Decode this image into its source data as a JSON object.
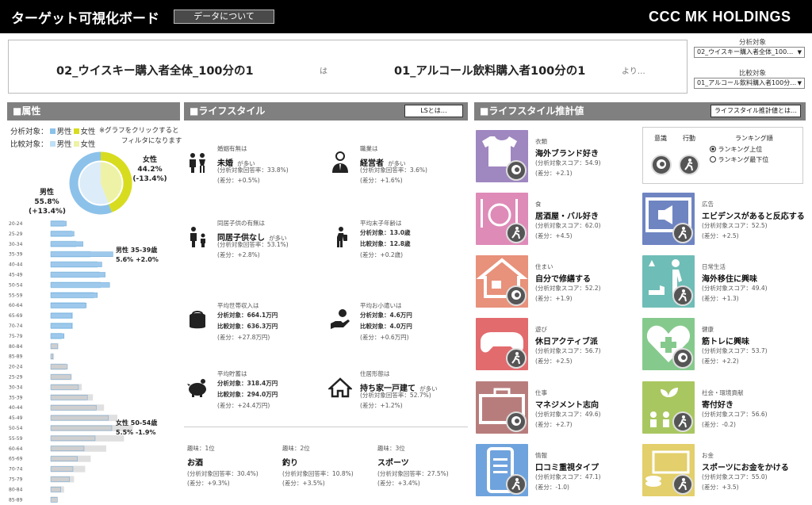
{
  "header": {
    "title": "ターゲット可視化ボード",
    "about_button": "データについて",
    "logo": "CCC MK HOLDINGS"
  },
  "comparison": {
    "target": "02_ウイスキー購入者全体_100分の1",
    "connector": "は",
    "base": "01_アルコール飲料購入者100分の1",
    "suffix": "より…",
    "target_select_label": "分析対象",
    "target_select_value": "02_ウイスキー購入者全体_100…",
    "base_select_label": "比較対象",
    "base_select_value": "01_アルコール飲料購入者100分…"
  },
  "attributes": {
    "heading": "■属性",
    "legend_target_label": "分析対象：",
    "legend_base_label": "比較対象：",
    "male": "男性",
    "female": "女性",
    "note_line1": "※グラフをクリックすると",
    "note_line2": "フィルタになります",
    "female_label": "女性",
    "female_pct": "44.2%",
    "female_diff": "(-13.4%)",
    "male_label": "男性",
    "male_pct": "55.8%",
    "male_diff": "(+13.4%)",
    "male_peak": "男性 35-39歳",
    "male_peak_val": "5.6% +2.0%",
    "female_peak": "女性 50-54歳",
    "female_peak_val": "5.5% -1.9%",
    "age_groups": [
      "20-24",
      "25-29",
      "30-34",
      "35-39",
      "40-44",
      "45-49",
      "50-54",
      "55-59",
      "60-64",
      "65-69",
      "70-74",
      "75-79",
      "80-84",
      "85-89"
    ],
    "male_target": [
      1.4,
      2.1,
      2.9,
      5.6,
      4.6,
      4.9,
      5.3,
      4.2,
      3.2,
      1.9,
      1.9,
      1.2,
      0,
      0
    ],
    "male_base": [
      1.2,
      1.9,
      2.3,
      3.6,
      4.2,
      4.4,
      4.5,
      3.9,
      3.1,
      2.0,
      2.0,
      1.0,
      0,
      0
    ],
    "female_target": [
      0,
      0,
      0,
      0,
      0,
      0,
      0,
      0,
      0,
      0,
      0,
      0,
      0.6,
      0.2
    ],
    "female_base": [
      0,
      0,
      0,
      0,
      0,
      0,
      0,
      0,
      0,
      0,
      0,
      0,
      0.7,
      0.3
    ],
    "female_ages": [
      "20-24",
      "25-29",
      "30-34",
      "35-39",
      "40-44",
      "45-49",
      "50-54",
      "55-59",
      "60-64",
      "65-69",
      "70-74",
      "75-79",
      "80-84",
      "85-89"
    ],
    "female_target2": [
      1.5,
      1.8,
      2.5,
      3.3,
      4.1,
      5.2,
      5.5,
      4.0,
      3.0,
      2.4,
      2.0,
      1.7,
      0.9,
      0.6
    ],
    "female_base2": [
      1.4,
      1.9,
      2.8,
      3.8,
      4.8,
      6.0,
      7.4,
      6.6,
      5.0,
      3.6,
      3.1,
      2.1,
      1.2,
      0.6
    ],
    "colors": {
      "male_target": "#9ec9ec",
      "male_base": "#bfe0f5",
      "female_target": "#cfcfcf",
      "female_base": "#e0e0e0",
      "donut_male": "#8cc2ea",
      "donut_female": "#d8dc1f"
    }
  },
  "lifestyle": {
    "heading": "■ライフスタイル",
    "button": "LSとは…",
    "items": [
      {
        "cat": "婚姻有無は",
        "main": "未婚",
        "tag": "が多い",
        "l1": "(分析対象回答率：33.8%)",
        "l2": "(差分：+0.5%)",
        "icon": "couple-icon"
      },
      {
        "cat": "職業は",
        "main": "経営者",
        "tag": "が多い",
        "l1": "(分析対象回答率：3.6%)",
        "l2": "(差分：+1.6%)",
        "icon": "executive-icon"
      },
      {
        "cat": "同居子供の有無は",
        "main": "同居子供なし",
        "tag": "が多い",
        "l1": "(分析対象回答率：53.1%)",
        "l2": "(差分：+2.8%)",
        "icon": "parent-child-icon"
      },
      {
        "cat": "平均末子年齢は",
        "main": "",
        "tag": "",
        "l1": "分析対象：13.0歳",
        "l2": "比較対象：12.8歳",
        "l3": "(差分：+0.2歳)",
        "icon": "child-walking-icon"
      },
      {
        "cat": "平均世帯収入は",
        "main": "",
        "tag": "",
        "l1": "分析対象：664.1万円",
        "l2": "比較対象：636.3万円",
        "l3": "(差分：+27.8万円)",
        "icon": "wallet-icon"
      },
      {
        "cat": "平均お小遣いは",
        "main": "",
        "tag": "",
        "l1": "分析対象：4.6万円",
        "l2": "比較対象：4.0万円",
        "l3": "(差分：+0.6万円)",
        "icon": "hand-coin-icon"
      },
      {
        "cat": "平均貯蓄は",
        "main": "",
        "tag": "",
        "l1": "分析対象：318.4万円",
        "l2": "比較対象：294.0万円",
        "l3": "(差分：+24.4万円)",
        "icon": "piggy-bank-icon"
      },
      {
        "cat": "住居形態は",
        "main": "持ち家一戸建て",
        "tag": "が多い",
        "l1": "(分析対象回答率：52.7%)",
        "l2": "(差分：+1.2%)",
        "icon": "house-icon"
      }
    ],
    "hobbies": [
      {
        "rank": "趣味：1位",
        "main": "お酒",
        "l1": "(分析対象回答率：30.4%)",
        "l2": "(差分：+9.3%)"
      },
      {
        "rank": "趣味：2位",
        "main": "釣り",
        "l1": "(分析対象回答率：10.8%)",
        "l2": "(差分：+3.5%)"
      },
      {
        "rank": "趣味：3位",
        "main": "スポーツ",
        "l1": "(分析対象回答率：27.5%)",
        "l2": "(差分：+3.4%)"
      }
    ]
  },
  "estimates": {
    "heading": "■ライフスタイル推計値",
    "button": "ライフスタイル推計値とは…",
    "legend": {
      "awareness": "意識",
      "action": "行動",
      "ranking_title": "ランキング順",
      "opt_top": "ランキング上位",
      "opt_bottom": "ランキング最下位"
    },
    "left": [
      {
        "cat": "衣類",
        "main": "海外ブランド好き",
        "score": "(分析対象スコア：54.9)",
        "diff": "(差分：+2.1)",
        "color": "#9f87c0",
        "icon": "tshirt-icon",
        "badge": "awareness-icon"
      },
      {
        "cat": "食",
        "main": "居酒屋・バル好き",
        "score": "(分析対象スコア：62.0)",
        "diff": "(差分：+4.5)",
        "color": "#de8bb8",
        "icon": "dining-icon",
        "badge": "action-icon"
      },
      {
        "cat": "住まい",
        "main": "自分で修繕する",
        "score": "(分析対象スコア：52.2)",
        "diff": "(差分：+1.9)",
        "color": "#e8917b",
        "icon": "home-icon",
        "badge": "awareness-icon"
      },
      {
        "cat": "遊び",
        "main": "休日アクティブ派",
        "score": "(分析対象スコア：56.7)",
        "diff": "(差分：+2.5)",
        "color": "#e26b6e",
        "icon": "gamepad-icon",
        "badge": "action-icon"
      },
      {
        "cat": "仕事",
        "main": "マネジメント志向",
        "score": "(分析対象スコア：49.6)",
        "diff": "(差分：+2.7)",
        "color": "#b77d7c",
        "icon": "briefcase-icon",
        "badge": "awareness-icon"
      },
      {
        "cat": "情報",
        "main": "口コミ重視タイプ",
        "score": "(分析対象スコア：47.1)",
        "diff": "(差分：-1.0)",
        "color": "#6fa3dd",
        "icon": "phone-icon",
        "badge": "action-icon"
      }
    ],
    "right": [
      {
        "cat": "広告",
        "main": "エビデンスがあると反応する",
        "score": "(分析対象スコア：52.5)",
        "diff": "(差分：+2.5)",
        "color": "#6f85c2",
        "icon": "advertising-icon",
        "badge": "action-icon"
      },
      {
        "cat": "日常生活",
        "main": "海外移住に興味",
        "score": "(分析対象スコア：49.4)",
        "diff": "(差分：+1.3)",
        "color": "#6fbdb7",
        "icon": "dog-walk-icon",
        "badge": "action-icon"
      },
      {
        "cat": "健康",
        "main": "筋トレに興味",
        "score": "(分析対象スコア：53.7)",
        "diff": "(差分：+2.2)",
        "color": "#86c98d",
        "icon": "heart-cross-icon",
        "badge": "awareness-icon"
      },
      {
        "cat": "社会・環境貢献",
        "main": "寄付好き",
        "score": "(分析対象スコア：56.6)",
        "diff": "(差分：-0.2)",
        "color": "#a9c760",
        "icon": "sprout-people-icon",
        "badge": "action-icon"
      },
      {
        "cat": "お金",
        "main": "スポーツにお金をかける",
        "score": "(分析対象スコア：55.0)",
        "diff": "(差分：+3.5)",
        "color": "#e3cf6b",
        "icon": "money-icon",
        "badge": "action-icon"
      }
    ]
  }
}
